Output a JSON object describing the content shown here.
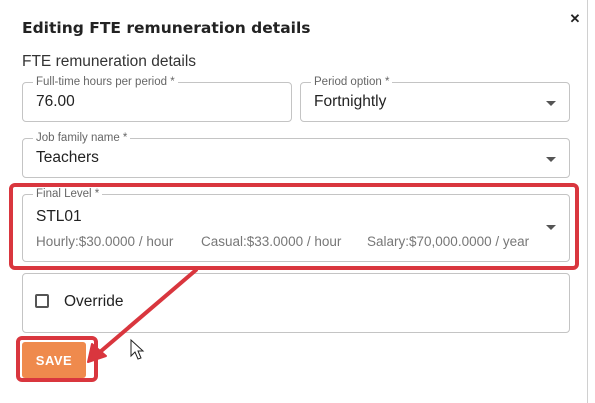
{
  "dialog": {
    "title": "Editing FTE remuneration details",
    "section_heading": "FTE remuneration details"
  },
  "fields": {
    "fulltime_hours": {
      "label": "Full-time hours per period *",
      "value": "76.00"
    },
    "period_option": {
      "label": "Period option *",
      "value": "Fortnightly"
    },
    "job_family": {
      "label": "Job family name *",
      "value": "Teachers"
    },
    "final_level": {
      "label": "Final Level *",
      "value": "STL01",
      "hourly": "Hourly:$30.0000 / hour",
      "casual": "Casual:$33.0000 / hour",
      "salary": "Salary:$70,000.0000 / year"
    }
  },
  "override": {
    "label": "Override",
    "checked": false
  },
  "actions": {
    "save_label": "SAVE"
  },
  "icons": {
    "close": "close-icon",
    "caret": "caret-down-icon",
    "cursor": "mouse-pointer-icon"
  },
  "colors": {
    "accent": "#ef8a4d",
    "annotation_red": "#d9363e"
  }
}
